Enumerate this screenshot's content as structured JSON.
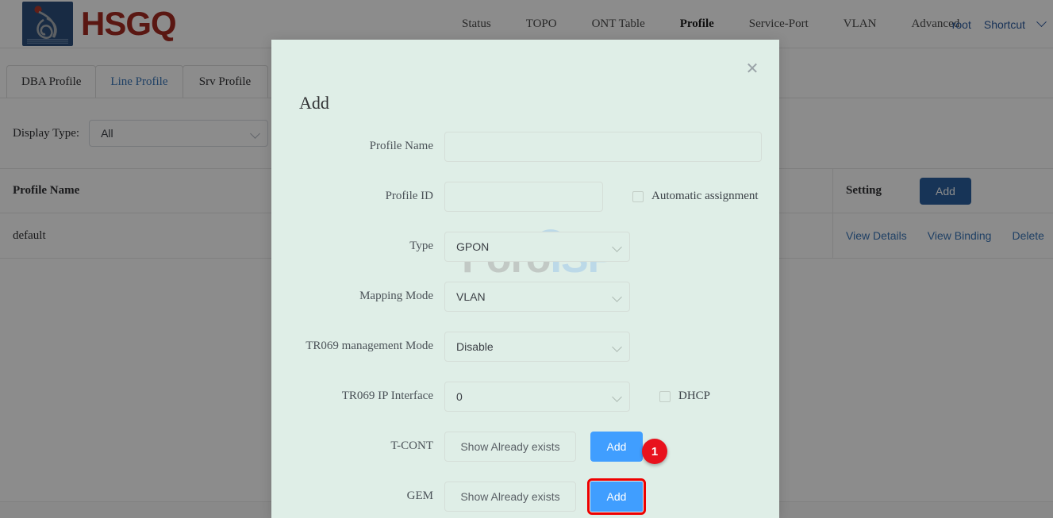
{
  "brand": {
    "name": "HSGQ",
    "logo_color": "#a42a21",
    "logo_tile_color": "#2c4f7c"
  },
  "nav": {
    "items": [
      {
        "label": "Status",
        "active": false
      },
      {
        "label": "TOPO",
        "active": false
      },
      {
        "label": "ONT Table",
        "active": false
      },
      {
        "label": "Profile",
        "active": true
      },
      {
        "label": "Service-Port",
        "active": false
      },
      {
        "label": "VLAN",
        "active": false
      },
      {
        "label": "Advanced",
        "active": false
      }
    ],
    "user": "root",
    "shortcut": "Shortcut"
  },
  "tabs": [
    {
      "label": "DBA Profile",
      "active": false
    },
    {
      "label": "Line Profile",
      "active": true
    },
    {
      "label": "Srv Profile",
      "active": false
    }
  ],
  "filter": {
    "display_type_label": "Display Type:",
    "display_type_value": "All"
  },
  "table": {
    "columns": [
      "Profile Name",
      "Setting"
    ],
    "add_button": "Add",
    "rows": [
      {
        "profile_name": "default",
        "actions": [
          "View Details",
          "View Binding",
          "Delete"
        ]
      }
    ]
  },
  "watermark": {
    "part1": "Foro",
    "part2": "ISP"
  },
  "dialog": {
    "title": "Add",
    "close_icon": "close-icon",
    "fields": {
      "profile_name": {
        "label": "Profile Name",
        "value": "",
        "placeholder": ""
      },
      "profile_id": {
        "label": "Profile ID",
        "value": "",
        "placeholder": ""
      },
      "automatic_assignment": {
        "label": "Automatic assignment",
        "checked": false
      },
      "type": {
        "label": "Type",
        "value": "GPON"
      },
      "mapping_mode": {
        "label": "Mapping Mode",
        "value": "VLAN"
      },
      "tr069_management_mode": {
        "label": "TR069 management Mode",
        "value": "Disable"
      },
      "tr069_ip_interface": {
        "label": "TR069 IP Interface",
        "value": "0"
      },
      "dhcp": {
        "label": "DHCP",
        "checked": false
      },
      "tcont": {
        "label": "T-CONT",
        "show_button": "Show Already exists",
        "add_button": "Add"
      },
      "gem": {
        "label": "GEM",
        "show_button": "Show Already exists",
        "add_button": "Add"
      }
    }
  },
  "annotation": {
    "badge_number": "1",
    "badge_color": "#e8121d",
    "target": "gem-add-button"
  }
}
